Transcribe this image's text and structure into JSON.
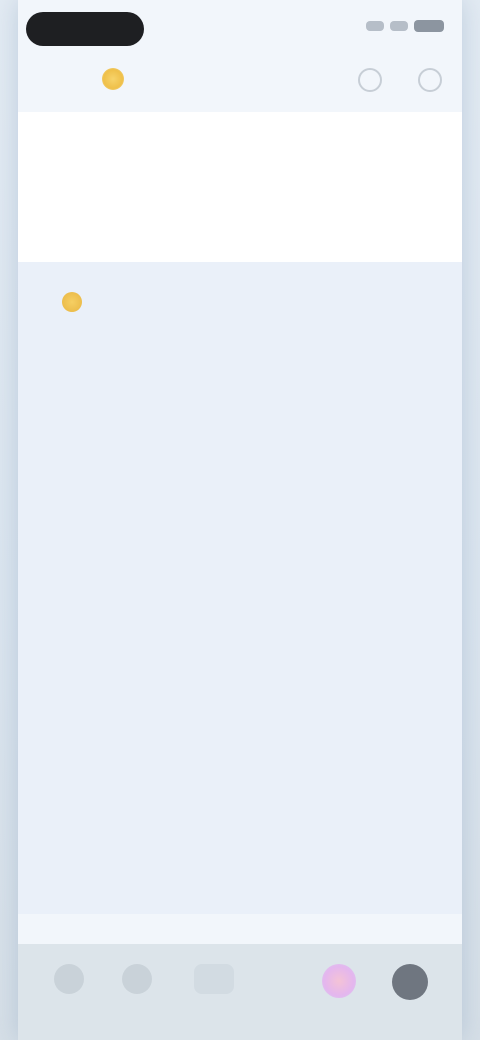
{
  "status_bar": {
    "icons": [
      "signal-icon",
      "wifi-icon",
      "battery-icon"
    ]
  },
  "top_bar": {
    "logo_text": "",
    "icons": [
      "settings-icon",
      "account-icon"
    ]
  },
  "article": {
    "heading": "",
    "paragraphs": [
      "",
      "",
      "",
      ""
    ],
    "link_paragraph": {
      "text_before": "",
      "link_text": "",
      "text_after": ""
    }
  },
  "bottom_bar": {
    "icons": [
      "back-arrow-icon",
      "forward-arrow-icon",
      "share-icon",
      "ai-assistant-icon",
      "tabs-icon"
    ]
  },
  "colors": {
    "background": "#eaf0f9",
    "text": "#7c8a9b",
    "link": "#3e62b3",
    "accent_yellow": "#efc04a",
    "bottom_bar": "#dce4ea"
  }
}
